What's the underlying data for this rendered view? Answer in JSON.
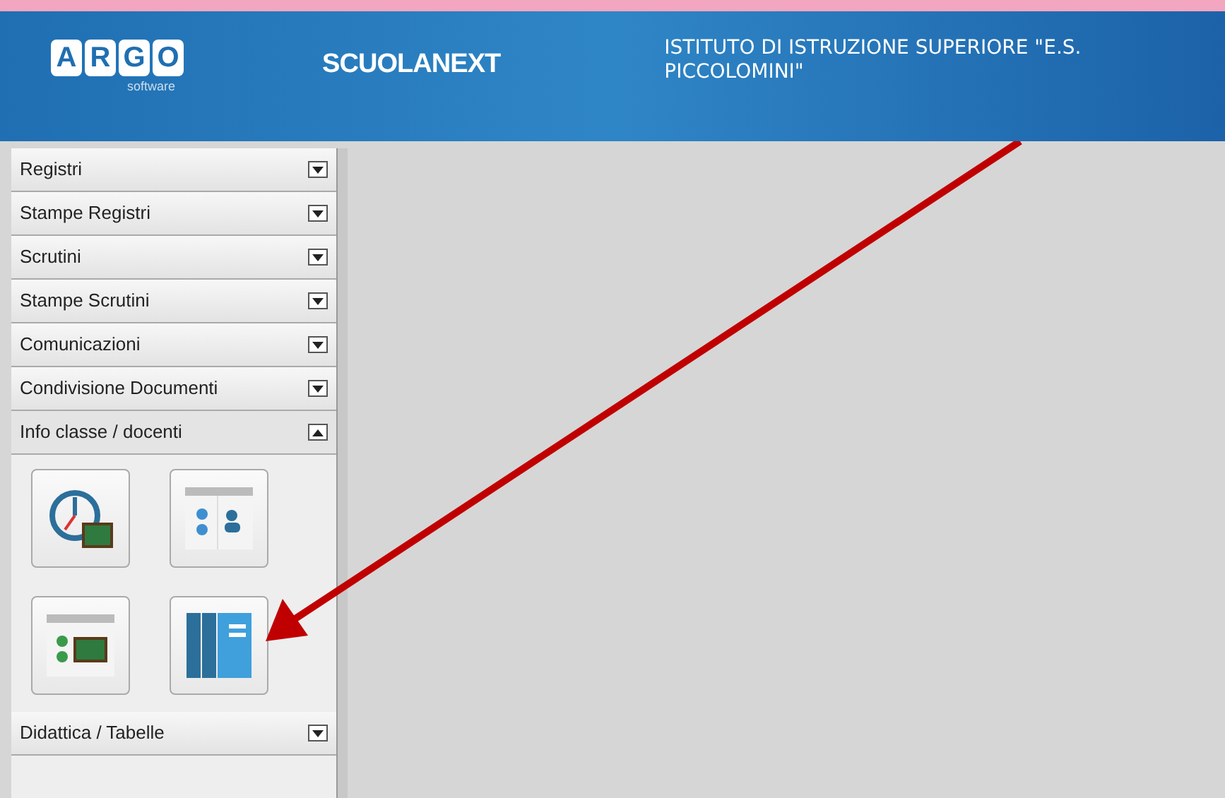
{
  "header": {
    "logo_letters": [
      "A",
      "R",
      "G",
      "O"
    ],
    "logo_subtitle": "software",
    "product": "SCUOLANEXT",
    "school": "ISTITUTO DI ISTRUZIONE SUPERIORE \"E.S. PICCOLOMINI\""
  },
  "sidebar": {
    "sections": [
      {
        "label": "Registri",
        "expanded": false
      },
      {
        "label": "Stampe Registri",
        "expanded": false
      },
      {
        "label": "Scrutini",
        "expanded": false
      },
      {
        "label": "Stampe Scrutini",
        "expanded": false
      },
      {
        "label": "Comunicazioni",
        "expanded": false
      },
      {
        "label": "Condivisione Documenti",
        "expanded": false
      },
      {
        "label": "Info classe / docenti",
        "expanded": true,
        "tiles": [
          {
            "kind": "clock"
          },
          {
            "kind": "class-people"
          },
          {
            "kind": "class-board"
          },
          {
            "kind": "columns"
          }
        ]
      },
      {
        "label": "Didattica / Tabelle",
        "expanded": false
      }
    ]
  },
  "annotation": {
    "kind": "arrow"
  }
}
